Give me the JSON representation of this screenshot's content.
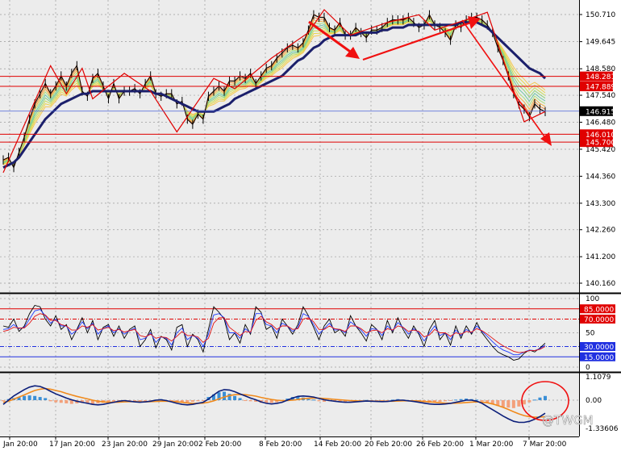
{
  "colors": {
    "background": "#ececec",
    "grid": "#9a9a9a",
    "price_line": "#000000",
    "ma_thick": "#1b1f6b",
    "level_red": "#e00000",
    "level_blue": "#2030e0",
    "current_price_line": "#4a62d8",
    "rsi_black": "#000000",
    "rsi_blue": "#1e3cff",
    "rsi_red": "#e01010",
    "hist_pos": "#3a8fd6",
    "hist_neg": "#f3a07a",
    "macd_line": "#0c1f7a",
    "signal_line": "#f08a1c",
    "arrow": "#f01010",
    "ribbon": [
      "#f4c850",
      "#e9d44a",
      "#c8de56",
      "#8fd17a",
      "#6cc6a4",
      "#a8e07a",
      "#f0b040",
      "#ea8a38",
      "#e86a30"
    ]
  },
  "chart_data": [
    {
      "type": "line",
      "panel": "price",
      "x_ticks": [
        "Jan 20:00",
        "17 Jan 20:00",
        "23 Jan 20:00",
        "29 Jan 20:00",
        "2 Feb 20:00",
        "8 Feb 20:00",
        "14 Feb 20:00",
        "20 Feb 20:00",
        "26 Feb 20:00",
        "1 Mar 20:00",
        "7 Mar 20:00"
      ],
      "y_ticks": [
        "150.710",
        "149.645",
        "148.580",
        "147.540",
        "146.480",
        "145.420",
        "144.360",
        "143.300",
        "142.260",
        "141.200",
        "140.160"
      ],
      "ylim": [
        139.9,
        151.2
      ],
      "y_tick_values": [
        150.71,
        149.645,
        148.58,
        147.54,
        146.48,
        145.42,
        144.36,
        143.3,
        142.26,
        141.2,
        140.16
      ],
      "levels": [
        {
          "label": "148.281",
          "value": 148.281,
          "color": "#e00000"
        },
        {
          "label": "147.889",
          "value": 147.889,
          "color": "#e00000"
        },
        {
          "label": "146.010",
          "value": 146.01,
          "color": "#e00000"
        },
        {
          "label": "145.700",
          "value": 145.7,
          "color": "#e00000"
        }
      ],
      "current_price": {
        "label": "146.915",
        "value": 146.915
      },
      "close": [
        145.0,
        145.1,
        144.7,
        145.3,
        145.9,
        146.6,
        147.2,
        147.6,
        148.0,
        147.6,
        147.9,
        148.3,
        147.9,
        148.4,
        148.7,
        147.7,
        147.5,
        148.2,
        148.4,
        147.9,
        147.4,
        148.0,
        147.4,
        147.7,
        147.7,
        147.8,
        147.6,
        148.0,
        148.3,
        147.6,
        147.5,
        147.6,
        147.6,
        147.2,
        147.3,
        146.6,
        146.4,
        146.8,
        146.6,
        147.5,
        147.7,
        147.9,
        147.7,
        148.1,
        148.1,
        148.3,
        148.2,
        148.4,
        148.0,
        148.3,
        148.6,
        148.7,
        149.0,
        149.2,
        149.4,
        149.5,
        149.4,
        149.6,
        150.1,
        150.7,
        150.6,
        150.6,
        150.2,
        150.1,
        150.4,
        149.9,
        149.9,
        150.2,
        150.0,
        149.8,
        150.1,
        150.1,
        150.2,
        150.4,
        150.5,
        150.5,
        150.5,
        150.6,
        150.4,
        150.2,
        150.3,
        150.7,
        150.3,
        150.2,
        150.0,
        149.7,
        150.3,
        150.2,
        150.5,
        150.6,
        150.6,
        150.5,
        150.3,
        150.0,
        149.4,
        148.9,
        148.3,
        147.6,
        147.2,
        147.0,
        146.7,
        147.2,
        147.0,
        146.9
      ],
      "ma": [
        144.7,
        144.8,
        144.9,
        145.1,
        145.4,
        145.7,
        146.0,
        146.3,
        146.6,
        146.8,
        147.0,
        147.2,
        147.3,
        147.4,
        147.5,
        147.6,
        147.6,
        147.7,
        147.7,
        147.7,
        147.7,
        147.7,
        147.7,
        147.7,
        147.7,
        147.7,
        147.7,
        147.7,
        147.7,
        147.6,
        147.6,
        147.5,
        147.4,
        147.3,
        147.2,
        147.1,
        147.0,
        146.9,
        146.9,
        146.9,
        146.9,
        147.0,
        147.1,
        147.2,
        147.4,
        147.5,
        147.6,
        147.7,
        147.8,
        147.9,
        148.0,
        148.1,
        148.2,
        148.3,
        148.5,
        148.7,
        148.9,
        149.0,
        149.2,
        149.4,
        149.5,
        149.7,
        149.8,
        149.9,
        149.9,
        149.9,
        149.9,
        149.9,
        150.0,
        150.0,
        150.0,
        150.0,
        150.1,
        150.1,
        150.2,
        150.2,
        150.2,
        150.3,
        150.3,
        150.3,
        150.3,
        150.3,
        150.3,
        150.3,
        150.3,
        150.3,
        150.3,
        150.4,
        150.4,
        150.4,
        150.4,
        150.3,
        150.2,
        150.0,
        149.8,
        149.6,
        149.4,
        149.2,
        149.0,
        148.8,
        148.6,
        148.5,
        148.4,
        148.2
      ],
      "zigzag": [
        [
          0,
          144.5
        ],
        [
          9,
          148.7
        ],
        [
          12,
          147.6
        ],
        [
          15,
          148.6
        ],
        [
          17,
          147.4
        ],
        [
          23,
          148.4
        ],
        [
          28,
          147.7
        ],
        [
          33,
          146.1
        ],
        [
          40,
          148.2
        ],
        [
          44,
          147.8
        ],
        [
          51,
          149.0
        ],
        [
          58,
          150.0
        ],
        [
          61,
          150.9
        ],
        [
          66,
          149.9
        ],
        [
          73,
          150.4
        ],
        [
          79,
          150.7
        ],
        [
          82,
          150.1
        ],
        [
          88,
          150.5
        ],
        [
          92,
          150.8
        ],
        [
          99,
          146.5
        ],
        [
          103,
          146.9
        ]
      ]
    },
    {
      "type": "line",
      "panel": "oscillator",
      "y_ticks": [
        "100",
        "50",
        "0"
      ],
      "ylim": [
        0,
        100
      ],
      "levels": [
        {
          "label": "85.0000",
          "value": 85,
          "color": "#e00000"
        },
        {
          "label": "70.0000",
          "value": 70,
          "color": "#e00000"
        },
        {
          "label": "30.0000",
          "value": 30,
          "color": "#2030e0"
        },
        {
          "label": "15.0000",
          "value": 15,
          "color": "#2030e0"
        }
      ],
      "series": [
        {
          "color": "#000000",
          "values": [
            60,
            58,
            70,
            52,
            60,
            78,
            90,
            88,
            70,
            60,
            75,
            55,
            62,
            40,
            55,
            72,
            50,
            68,
            40,
            58,
            62,
            45,
            60,
            42,
            55,
            60,
            30,
            40,
            55,
            28,
            45,
            40,
            25,
            58,
            62,
            30,
            48,
            40,
            22,
            55,
            88,
            80,
            70,
            40,
            50,
            35,
            62,
            48,
            88,
            80,
            55,
            60,
            42,
            70,
            60,
            48,
            62,
            88,
            75,
            58,
            40,
            60,
            70,
            50,
            55,
            45,
            75,
            60,
            50,
            38,
            62,
            55,
            40,
            68,
            50,
            72,
            55,
            42,
            60,
            48,
            30,
            55,
            68,
            40,
            50,
            32,
            60,
            42,
            60,
            48,
            65,
            50,
            40,
            30,
            22,
            18,
            15,
            10,
            12,
            20,
            25,
            22,
            28,
            35
          ]
        },
        {
          "color": "#1e3cff",
          "values": [
            55,
            56,
            62,
            56,
            58,
            70,
            82,
            84,
            75,
            64,
            70,
            60,
            60,
            48,
            54,
            66,
            56,
            64,
            48,
            56,
            60,
            50,
            56,
            48,
            53,
            57,
            40,
            42,
            50,
            36,
            44,
            42,
            32,
            50,
            57,
            40,
            46,
            42,
            30,
            48,
            76,
            78,
            72,
            50,
            50,
            42,
            56,
            50,
            78,
            78,
            62,
            60,
            50,
            64,
            60,
            52,
            58,
            78,
            74,
            62,
            48,
            56,
            64,
            54,
            55,
            50,
            66,
            60,
            54,
            45,
            56,
            55,
            46,
            60,
            53,
            65,
            58,
            48,
            56,
            50,
            38,
            50,
            60,
            46,
            50,
            40,
            54,
            46,
            55,
            50,
            60,
            52,
            45,
            37,
            30,
            25,
            22,
            18,
            18,
            22,
            25,
            24,
            27,
            32
          ]
        },
        {
          "color": "#e01010",
          "values": [
            52,
            54,
            58,
            57,
            57,
            64,
            74,
            78,
            76,
            68,
            68,
            62,
            60,
            54,
            54,
            60,
            58,
            62,
            54,
            56,
            58,
            53,
            55,
            51,
            53,
            55,
            46,
            44,
            48,
            42,
            44,
            43,
            38,
            45,
            52,
            46,
            46,
            44,
            36,
            42,
            64,
            72,
            72,
            58,
            52,
            46,
            52,
            51,
            68,
            74,
            66,
            62,
            55,
            60,
            60,
            55,
            56,
            70,
            72,
            66,
            55,
            55,
            60,
            56,
            55,
            52,
            60,
            60,
            56,
            50,
            53,
            54,
            50,
            56,
            54,
            60,
            58,
            52,
            54,
            52,
            44,
            47,
            55,
            50,
            50,
            45,
            50,
            48,
            52,
            51,
            56,
            53,
            48,
            42,
            36,
            31,
            27,
            23,
            21,
            22,
            24,
            24,
            26,
            30
          ]
        }
      ]
    },
    {
      "type": "bar",
      "panel": "macd",
      "y_ticks": [
        "1.1079",
        "0.00",
        "-1.33606"
      ],
      "ylim": [
        -1.33606,
        1.1079
      ],
      "histogram": [
        -0.1,
        0.1,
        0.2,
        0.3,
        0.4,
        0.45,
        0.4,
        0.3,
        0.2,
        -0.1,
        -0.2,
        -0.25,
        -0.3,
        -0.35,
        -0.3,
        -0.25,
        -0.3,
        -0.35,
        -0.3,
        -0.25,
        -0.2,
        -0.15,
        -0.1,
        -0.05,
        -0.1,
        -0.15,
        -0.2,
        -0.15,
        -0.1,
        0.05,
        0.1,
        -0.05,
        -0.15,
        -0.2,
        -0.25,
        -0.2,
        -0.15,
        -0.1,
        -0.05,
        0.3,
        0.55,
        0.75,
        0.8,
        0.6,
        0.4,
        0.2,
        -0.05,
        -0.1,
        -0.15,
        -0.25,
        -0.3,
        -0.25,
        -0.2,
        -0.1,
        0.15,
        0.3,
        0.35,
        0.25,
        0.1,
        0.05,
        -0.1,
        -0.15,
        -0.1,
        -0.05,
        -0.1,
        -0.15,
        -0.1,
        -0.05,
        -0.02,
        0.02,
        -0.05,
        -0.08,
        -0.1,
        -0.05,
        0.05,
        0.1,
        0.05,
        -0.05,
        -0.1,
        -0.15,
        -0.2,
        -0.25,
        -0.2,
        -0.15,
        -0.1,
        -0.05,
        0.05,
        0.1,
        0.15,
        0.1,
        0.05,
        -0.1,
        -0.25,
        -0.4,
        -0.55,
        -0.65,
        -0.7,
        -0.75,
        -0.6,
        -0.4,
        -0.2,
        0.05,
        0.25,
        0.4
      ],
      "macd": [
        -0.2,
        0.0,
        0.2,
        0.35,
        0.5,
        0.62,
        0.68,
        0.65,
        0.55,
        0.42,
        0.3,
        0.2,
        0.1,
        0.02,
        -0.05,
        -0.1,
        -0.15,
        -0.2,
        -0.22,
        -0.2,
        -0.15,
        -0.1,
        -0.05,
        -0.02,
        -0.05,
        -0.08,
        -0.1,
        -0.08,
        -0.05,
        0.0,
        0.02,
        -0.02,
        -0.08,
        -0.15,
        -0.2,
        -0.22,
        -0.2,
        -0.15,
        -0.1,
        0.05,
        0.25,
        0.42,
        0.5,
        0.48,
        0.4,
        0.3,
        0.2,
        0.1,
        0.02,
        -0.08,
        -0.15,
        -0.18,
        -0.15,
        -0.1,
        0.0,
        0.1,
        0.18,
        0.2,
        0.18,
        0.15,
        0.08,
        0.02,
        -0.02,
        -0.05,
        -0.08,
        -0.1,
        -0.1,
        -0.08,
        -0.06,
        -0.04,
        -0.05,
        -0.06,
        -0.07,
        -0.06,
        -0.03,
        0.0,
        0.0,
        -0.03,
        -0.06,
        -0.1,
        -0.14,
        -0.18,
        -0.2,
        -0.2,
        -0.18,
        -0.15,
        -0.1,
        -0.05,
        0.0,
        0.0,
        -0.05,
        -0.15,
        -0.3,
        -0.45,
        -0.6,
        -0.75,
        -0.88,
        -1.0,
        -1.05,
        -1.05,
        -1.0,
        -0.9,
        -0.78,
        -0.62
      ],
      "signal": [
        -0.1,
        -0.05,
        0.05,
        0.15,
        0.25,
        0.36,
        0.46,
        0.52,
        0.55,
        0.52,
        0.46,
        0.4,
        0.32,
        0.25,
        0.18,
        0.12,
        0.06,
        0.0,
        -0.05,
        -0.08,
        -0.1,
        -0.1,
        -0.09,
        -0.08,
        -0.07,
        -0.07,
        -0.08,
        -0.08,
        -0.07,
        -0.06,
        -0.05,
        -0.05,
        -0.06,
        -0.08,
        -0.1,
        -0.13,
        -0.15,
        -0.15,
        -0.14,
        -0.1,
        -0.03,
        0.06,
        0.15,
        0.22,
        0.26,
        0.27,
        0.26,
        0.23,
        0.19,
        0.13,
        0.08,
        0.03,
        0.0,
        -0.02,
        -0.02,
        0.0,
        0.03,
        0.07,
        0.09,
        0.1,
        0.1,
        0.08,
        0.06,
        0.04,
        0.02,
        0.0,
        -0.02,
        -0.03,
        -0.04,
        -0.04,
        -0.04,
        -0.05,
        -0.05,
        -0.05,
        -0.05,
        -0.04,
        -0.03,
        -0.03,
        -0.03,
        -0.04,
        -0.06,
        -0.08,
        -0.1,
        -0.12,
        -0.14,
        -0.15,
        -0.14,
        -0.13,
        -0.11,
        -0.09,
        -0.08,
        -0.09,
        -0.12,
        -0.18,
        -0.25,
        -0.34,
        -0.44,
        -0.55,
        -0.65,
        -0.73,
        -0.78,
        -0.8,
        -0.8,
        -0.78
      ]
    }
  ],
  "watermark": "@TWGM"
}
